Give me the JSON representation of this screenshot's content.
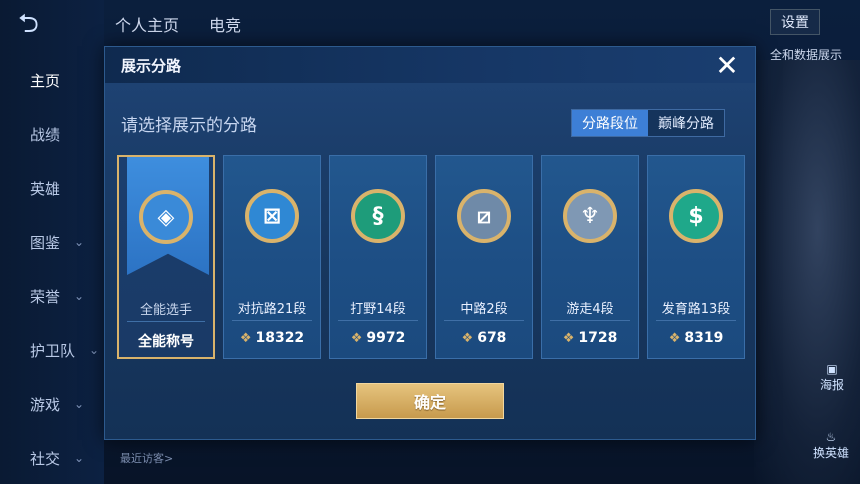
{
  "background": {
    "tabs": [
      "个人主页",
      "电竞"
    ],
    "settings_label": "设置",
    "right_note": "全和数据展示",
    "poster_label": "海报",
    "change_hero_label": "换英雄",
    "recent_visitors": "最近访客>"
  },
  "sidebar": {
    "items": [
      {
        "label": "主页",
        "active": true,
        "has_chevron": false
      },
      {
        "label": "战绩",
        "active": false,
        "has_chevron": false
      },
      {
        "label": "英雄",
        "active": false,
        "has_chevron": false
      },
      {
        "label": "图鉴",
        "active": false,
        "has_chevron": true
      },
      {
        "label": "荣誉",
        "active": false,
        "has_chevron": true
      },
      {
        "label": "护卫队",
        "active": false,
        "has_chevron": true
      },
      {
        "label": "游戏",
        "active": false,
        "has_chevron": true
      },
      {
        "label": "社交",
        "active": false,
        "has_chevron": true
      }
    ]
  },
  "modal": {
    "title": "展示分路",
    "prompt": "请选择展示的分路",
    "toggle": {
      "left": "分路段位",
      "right": "巅峰分路"
    },
    "confirm_label": "确定",
    "cards": [
      {
        "name": "全能选手",
        "value": "全能称号",
        "selected": true,
        "icon": "all-round-emblem",
        "color": "#3a8ad8"
      },
      {
        "name": "对抗路21段",
        "value": "18322",
        "selected": false,
        "icon": "clash-lane-emblem",
        "color": "#2f88d4"
      },
      {
        "name": "打野14段",
        "value": "9972",
        "selected": false,
        "icon": "jungle-emblem",
        "color": "#1e9c7a"
      },
      {
        "name": "中路2段",
        "value": "678",
        "selected": false,
        "icon": "mid-lane-emblem",
        "color": "#6f8aa8"
      },
      {
        "name": "游走4段",
        "value": "1728",
        "selected": false,
        "icon": "roam-emblem",
        "color": "#7f98b4"
      },
      {
        "name": "发育路13段",
        "value": "8319",
        "selected": false,
        "icon": "farm-lane-emblem",
        "color": "#1fa88a"
      }
    ]
  }
}
